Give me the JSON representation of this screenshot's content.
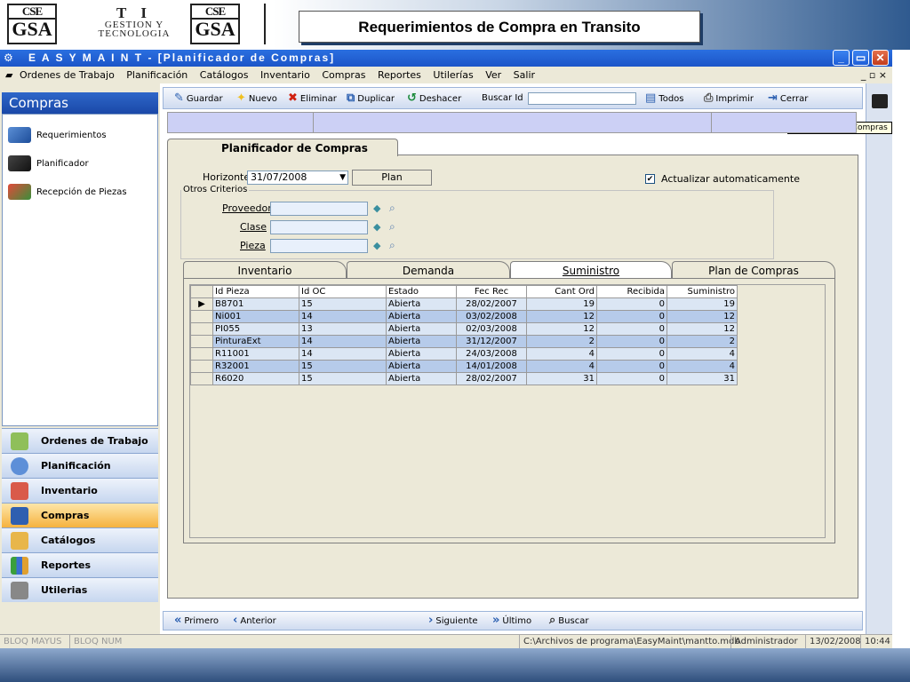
{
  "banner": {
    "logo1": {
      "top": "CSE",
      "bottom": "GSA"
    },
    "ti": {
      "line1": "T I",
      "line2": "GESTION Y",
      "line3": "TECNOLOGIA"
    },
    "logo2": {
      "top": "CSE",
      "bottom": "GSA"
    },
    "title": "Requerimientos de Compra en Transito"
  },
  "window": {
    "title": "E A S Y   M A I N T - [Planificador de Compras]",
    "controls": {
      "minimize": "_",
      "maximize": "▭",
      "close": "✕"
    },
    "mdi_controls": "_ ▫ ×"
  },
  "menubar": [
    "Ordenes de Trabajo",
    "Planificación",
    "Catálogos",
    "Inventario",
    "Compras",
    "Reportes",
    "Utilerías",
    "Ver",
    "Salir"
  ],
  "sidebar": {
    "header": "Compras",
    "items": [
      {
        "label": "Requerimientos",
        "icon": "pen-icon"
      },
      {
        "label": "Planificador",
        "icon": "calculator-icon"
      },
      {
        "label": "Recepción de Piezas",
        "icon": "truck-icon"
      }
    ],
    "nav": [
      {
        "label": "Ordenes de Trabajo",
        "icon": "clipboard-icon"
      },
      {
        "label": "Planificación",
        "icon": "clock-icon"
      },
      {
        "label": "Inventario",
        "icon": "shelf-icon"
      },
      {
        "label": "Compras",
        "icon": "buyer-icon",
        "active": true
      },
      {
        "label": "Catálogos",
        "icon": "book-icon"
      },
      {
        "label": "Reportes",
        "icon": "chart-icon"
      },
      {
        "label": "Utilerias",
        "icon": "tools-icon"
      }
    ]
  },
  "toolbar": {
    "guardar": "Guardar",
    "nuevo": "Nuevo",
    "eliminar": "Eliminar",
    "duplicar": "Duplicar",
    "deshacer": "Deshacer",
    "buscar_id": "Buscar Id",
    "todos": "Todos",
    "imprimir": "Imprimir",
    "cerrar": "Cerrar"
  },
  "tooltip": "Planificador de Compras",
  "form": {
    "tab_title": "Planificador de Compras",
    "horizonte_label": "Horizonte",
    "horizonte_value": "31/07/2008",
    "plan_button": "Plan",
    "auto_update_label": "Actualizar automaticamente",
    "auto_update_checked": true,
    "otros_criterios": "Otros Criterios",
    "proveedor": "Proveedor",
    "clase": "Clase",
    "pieza": "Pieza"
  },
  "tabs": [
    "Inventario",
    "Demanda",
    "Suministro",
    "Plan de Compras"
  ],
  "active_tab": "Suministro",
  "grid": {
    "columns": [
      "Id Pieza",
      "Id OC",
      "Estado",
      "Fec Rec",
      "Cant Ord",
      "Recibida",
      "Suministro"
    ],
    "rows": [
      [
        "B8701",
        "15",
        "Abierta",
        "28/02/2007",
        "19",
        "0",
        "19"
      ],
      [
        "Ni001",
        "14",
        "Abierta",
        "03/02/2008",
        "12",
        "0",
        "12"
      ],
      [
        "PI055",
        "13",
        "Abierta",
        "02/03/2008",
        "12",
        "0",
        "12"
      ],
      [
        "PinturaExt",
        "14",
        "Abierta",
        "31/12/2007",
        "2",
        "0",
        "2"
      ],
      [
        "R11001",
        "14",
        "Abierta",
        "24/03/2008",
        "4",
        "0",
        "4"
      ],
      [
        "R32001",
        "15",
        "Abierta",
        "14/01/2008",
        "4",
        "0",
        "4"
      ],
      [
        "R6020",
        "15",
        "Abierta",
        "28/02/2007",
        "31",
        "0",
        "31"
      ]
    ],
    "selected_marker": "▶"
  },
  "navbar": {
    "primero": "Primero",
    "anterior": "Anterior",
    "siguiente": "Siguiente",
    "ultimo": "Último",
    "buscar": "Buscar"
  },
  "status": {
    "caps": "BLOQ MAYUS",
    "num": "BLOQ NUM",
    "path": "C:\\Archivos de programa\\EasyMaint\\mantto.mdb",
    "user": "Administrador",
    "date": "13/02/2008",
    "time": "10:44"
  }
}
